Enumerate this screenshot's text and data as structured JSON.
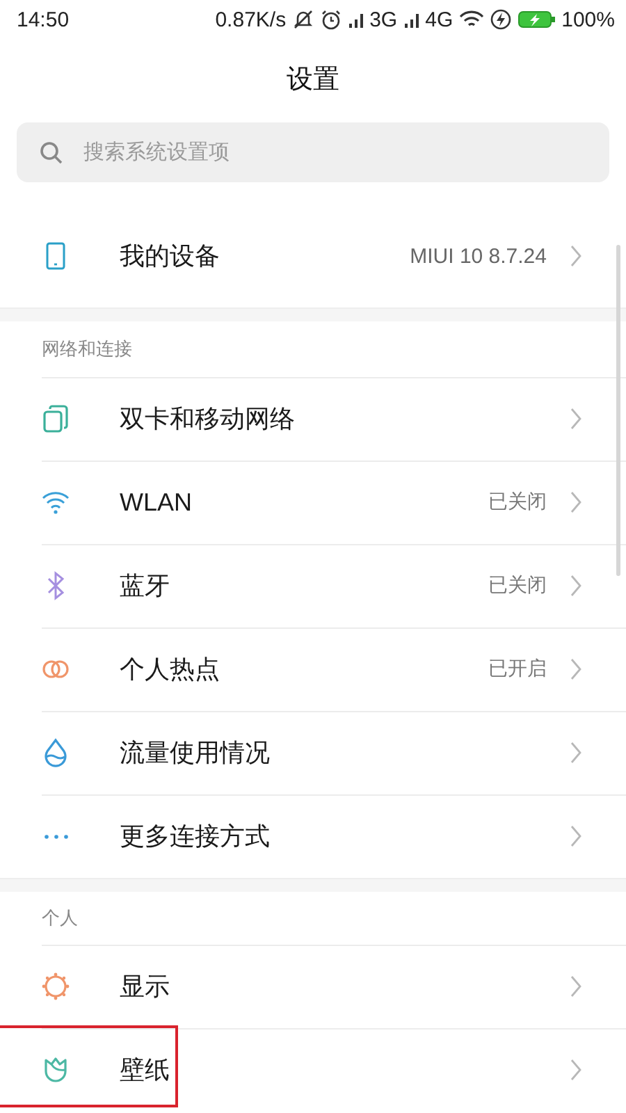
{
  "status_bar": {
    "time": "14:50",
    "speed": "0.87K/s",
    "network_1": "3G",
    "network_2": "4G",
    "battery": "100%"
  },
  "title": "设置",
  "search": {
    "placeholder": "搜索系统设置项"
  },
  "device": {
    "label": "我的设备",
    "value": "MIUI 10 8.7.24"
  },
  "sections": [
    {
      "header": "网络和连接",
      "items": [
        {
          "label": "双卡和移动网络",
          "highlighted": false
        },
        {
          "label": "WLAN",
          "value": "已关闭",
          "highlighted": false
        },
        {
          "label": "蓝牙",
          "value": "已关闭",
          "highlighted": false
        },
        {
          "label": "个人热点",
          "value": "已开启",
          "highlighted": false
        },
        {
          "label": "流量使用情况",
          "highlighted": false
        },
        {
          "label": "更多连接方式",
          "highlighted": false
        }
      ]
    },
    {
      "header": "个人",
      "items": [
        {
          "label": "显示",
          "highlighted": false
        },
        {
          "label": "壁纸",
          "highlighted": true
        }
      ]
    }
  ]
}
